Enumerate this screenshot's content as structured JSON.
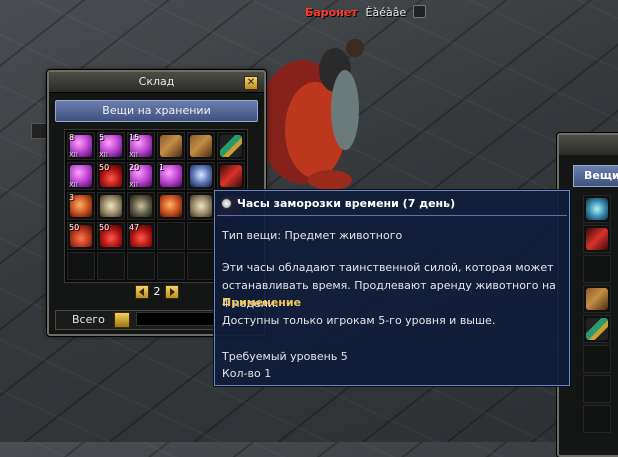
{
  "nameplate": {
    "rank": "Баронет",
    "nickname": "Èàéàâe"
  },
  "storage": {
    "title": "Склад",
    "tab": "Вещи на хранении",
    "slots": [
      {
        "art": "pink",
        "qty": "8",
        "sub": "XII"
      },
      {
        "art": "pink",
        "qty": "5",
        "sub": "XII"
      },
      {
        "art": "pink",
        "qty": "15",
        "sub": "XII"
      },
      {
        "art": "relic",
        "qty": "",
        "sub": ""
      },
      {
        "art": "relic",
        "qty": "",
        "sub": ""
      },
      {
        "art": "sword",
        "qty": "",
        "sub": ""
      },
      {
        "art": "pink",
        "qty": "",
        "sub": "XII"
      },
      {
        "art": "potion",
        "qty": "50",
        "sub": ""
      },
      {
        "art": "pink",
        "qty": "20",
        "sub": "XII"
      },
      {
        "art": "pink",
        "qty": "1",
        "sub": ""
      },
      {
        "art": "skull",
        "qty": "",
        "sub": ""
      },
      {
        "art": "red-gem",
        "qty": "",
        "sub": ""
      },
      {
        "art": "meat",
        "qty": "3",
        "sub": ""
      },
      {
        "art": "ornament",
        "qty": "",
        "sub": ""
      },
      {
        "art": "helm",
        "qty": "",
        "sub": ""
      },
      {
        "art": "meat",
        "qty": "",
        "sub": ""
      },
      {
        "art": "ornament",
        "qty": "",
        "sub": ""
      },
      {
        "art": "red-gem",
        "qty": "",
        "sub": ""
      },
      {
        "art": "jar",
        "qty": "50",
        "sub": ""
      },
      {
        "art": "potion",
        "qty": "50",
        "sub": ""
      },
      {
        "art": "potion",
        "qty": "47",
        "sub": ""
      },
      {
        "art": "",
        "qty": "",
        "sub": ""
      },
      {
        "art": "",
        "qty": "",
        "sub": ""
      },
      {
        "art": "",
        "qty": "",
        "sub": ""
      },
      {
        "art": "",
        "qty": "",
        "sub": ""
      },
      {
        "art": "",
        "qty": "",
        "sub": ""
      },
      {
        "art": "",
        "qty": "",
        "sub": ""
      },
      {
        "art": "",
        "qty": "",
        "sub": ""
      },
      {
        "art": "",
        "qty": "",
        "sub": ""
      },
      {
        "art": "",
        "qty": "",
        "sub": ""
      }
    ],
    "page": "2",
    "total_label": "Всего",
    "total_value": "0"
  },
  "right_window": {
    "tab": "Вещи",
    "slots": [
      {
        "art": "teal"
      },
      {
        "art": "red-gem"
      },
      {
        "art": ""
      },
      {
        "art": "relic"
      },
      {
        "art": "sword"
      },
      {
        "art": ""
      },
      {
        "art": ""
      },
      {
        "art": ""
      }
    ]
  },
  "tooltip": {
    "title": "Часы заморозки времени (7 день)",
    "type": "Тип вещи: Предмет животного",
    "description": "Эти часы обладают таинственной силой, которая может останавливать время. Продлевают аренду животного на 4 недели.",
    "usage_heading": "Применение",
    "usage": "Доступны только игрокам 5-го уровня и выше.",
    "required_level": "Требуемый уровень 5",
    "count": "Кол-во 1"
  }
}
